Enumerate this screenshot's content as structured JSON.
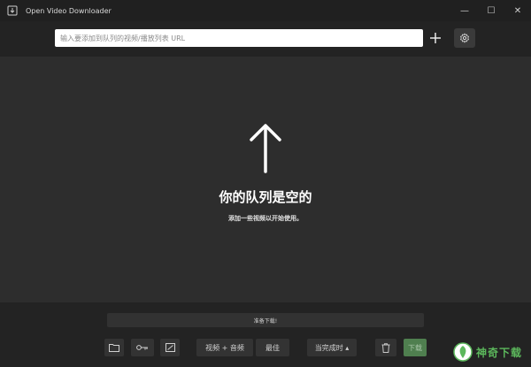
{
  "window": {
    "title": "Open Video Downloader",
    "minimize_glyph": "—",
    "maximize_glyph": "☐",
    "close_glyph": "✕"
  },
  "url_bar": {
    "placeholder": "输入要添加到队列的视频/播放列表 URL",
    "value": ""
  },
  "empty_state": {
    "title": "你的队列是空的",
    "subtitle": "添加一些视频以开始使用。"
  },
  "status": {
    "text": "准备下载!"
  },
  "toolbar": {
    "format_label": "视频 + 音频",
    "quality_label": "最佳",
    "on_complete_label": "当完成时 ▴",
    "download_label": "下载"
  },
  "watermark": {
    "text": "神奇下载"
  },
  "colors": {
    "titlebar": "#202020",
    "background": "#2d2d2d",
    "topbar": "#232323",
    "download_button": "#4f7f4f",
    "watermark_green": "#5cb85c"
  },
  "icons": {
    "app": "app-logo-icon",
    "add": "plus-icon",
    "settings": "gear-icon",
    "empty": "arrow-up-icon",
    "folder": "folder-icon",
    "key": "key-icon",
    "subtitles": "subtitles-icon",
    "delete": "trash-icon"
  }
}
